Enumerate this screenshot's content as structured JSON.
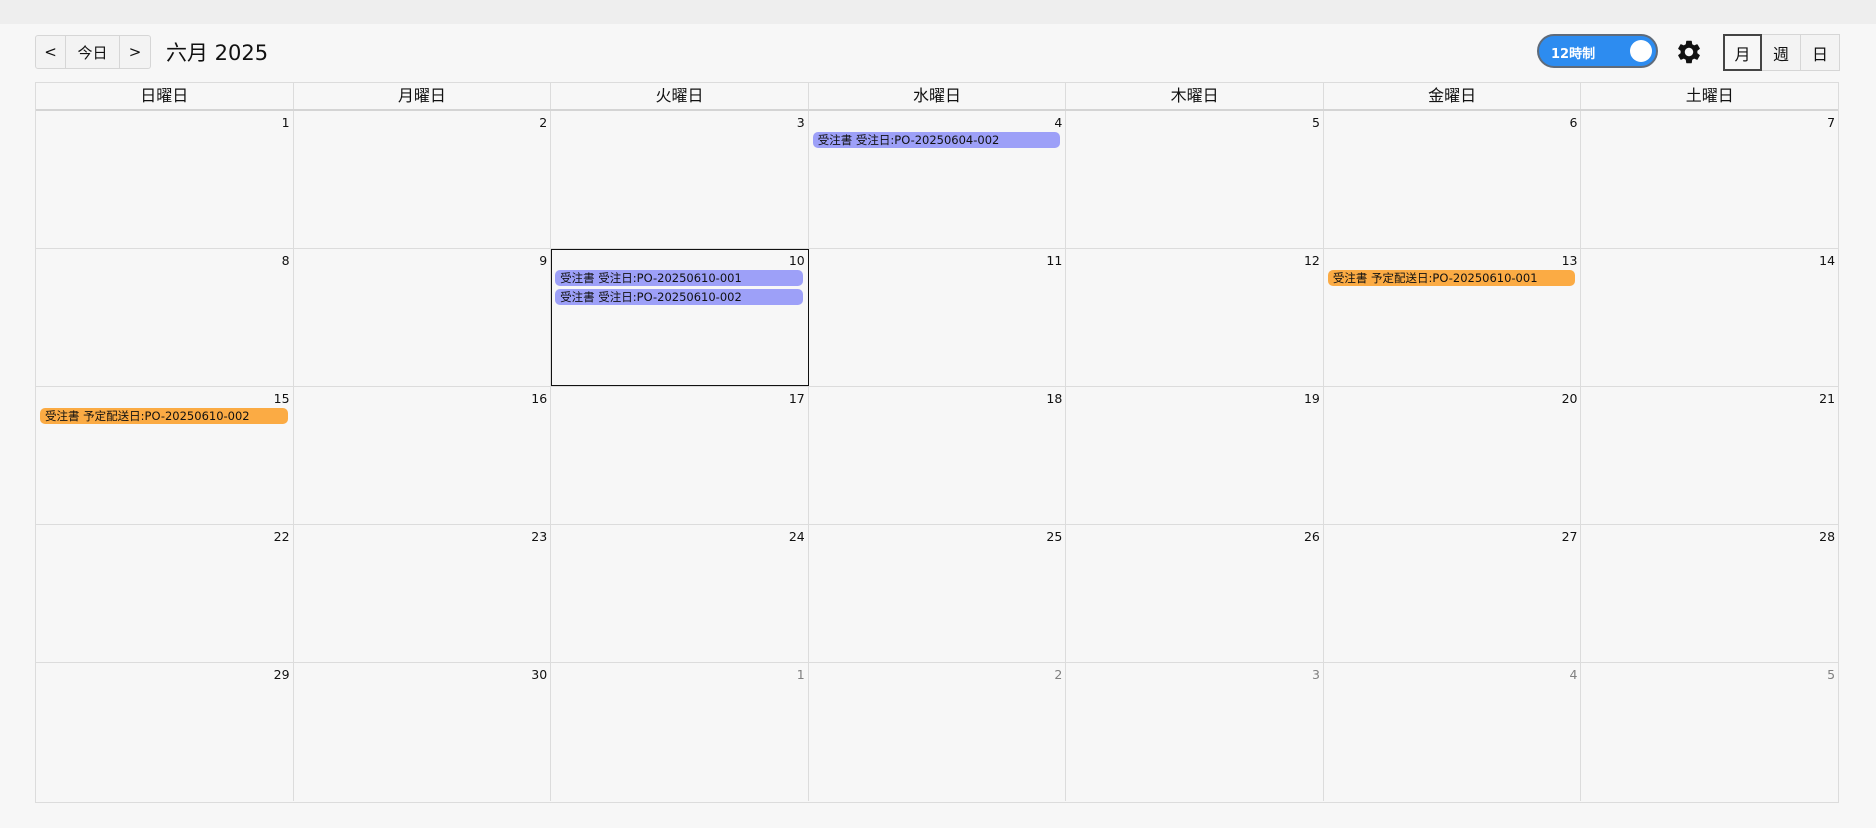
{
  "toolbar": {
    "prev_label": "<",
    "today_label": "今日",
    "next_label": ">",
    "title": "六月 2025",
    "toggle_label": "12時制",
    "settings_icon": "gear-icon",
    "views": [
      "月",
      "週",
      "日"
    ],
    "active_view": "月"
  },
  "colors": {
    "order_date": "#9da0f8",
    "delivery_date": "#fbab44",
    "toggle": "#2d8cf0"
  },
  "weekdays": [
    "日曜日",
    "月曜日",
    "火曜日",
    "水曜日",
    "木曜日",
    "金曜日",
    "土曜日"
  ],
  "today": 10,
  "weeks": [
    [
      {
        "day": "1",
        "other": false,
        "events": []
      },
      {
        "day": "2",
        "other": false,
        "events": []
      },
      {
        "day": "3",
        "other": false,
        "events": []
      },
      {
        "day": "4",
        "other": false,
        "events": [
          {
            "title": "受注書 受注日:PO-20250604-002",
            "kind": "order_date"
          }
        ]
      },
      {
        "day": "5",
        "other": false,
        "events": []
      },
      {
        "day": "6",
        "other": false,
        "events": []
      },
      {
        "day": "7",
        "other": false,
        "events": []
      }
    ],
    [
      {
        "day": "8",
        "other": false,
        "events": []
      },
      {
        "day": "9",
        "other": false,
        "events": []
      },
      {
        "day": "10",
        "other": false,
        "events": [
          {
            "title": "受注書 受注日:PO-20250610-001",
            "kind": "order_date"
          },
          {
            "title": "受注書 受注日:PO-20250610-002",
            "kind": "order_date"
          }
        ]
      },
      {
        "day": "11",
        "other": false,
        "events": []
      },
      {
        "day": "12",
        "other": false,
        "events": []
      },
      {
        "day": "13",
        "other": false,
        "events": [
          {
            "title": "受注書 予定配送日:PO-20250610-001",
            "kind": "delivery_date"
          }
        ]
      },
      {
        "day": "14",
        "other": false,
        "events": []
      }
    ],
    [
      {
        "day": "15",
        "other": false,
        "events": [
          {
            "title": "受注書 予定配送日:PO-20250610-002",
            "kind": "delivery_date"
          }
        ]
      },
      {
        "day": "16",
        "other": false,
        "events": []
      },
      {
        "day": "17",
        "other": false,
        "events": []
      },
      {
        "day": "18",
        "other": false,
        "events": []
      },
      {
        "day": "19",
        "other": false,
        "events": []
      },
      {
        "day": "20",
        "other": false,
        "events": []
      },
      {
        "day": "21",
        "other": false,
        "events": []
      }
    ],
    [
      {
        "day": "22",
        "other": false,
        "events": []
      },
      {
        "day": "23",
        "other": false,
        "events": []
      },
      {
        "day": "24",
        "other": false,
        "events": []
      },
      {
        "day": "25",
        "other": false,
        "events": []
      },
      {
        "day": "26",
        "other": false,
        "events": []
      },
      {
        "day": "27",
        "other": false,
        "events": []
      },
      {
        "day": "28",
        "other": false,
        "events": []
      }
    ],
    [
      {
        "day": "29",
        "other": false,
        "events": []
      },
      {
        "day": "30",
        "other": false,
        "events": []
      },
      {
        "day": "1",
        "other": true,
        "events": []
      },
      {
        "day": "2",
        "other": true,
        "events": []
      },
      {
        "day": "3",
        "other": true,
        "events": []
      },
      {
        "day": "4",
        "other": true,
        "events": []
      },
      {
        "day": "5",
        "other": true,
        "events": []
      }
    ]
  ]
}
